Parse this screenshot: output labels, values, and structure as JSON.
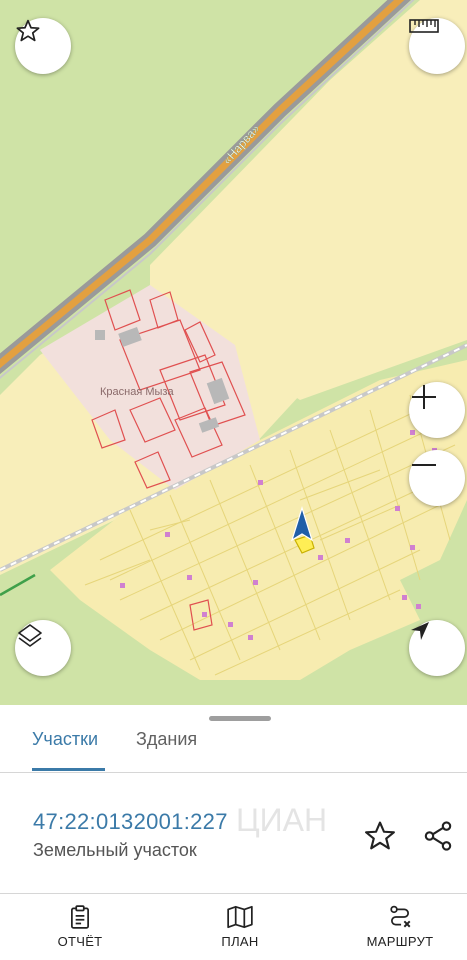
{
  "map": {
    "road_label": "«Нарва»",
    "village_label": "Красная Мыза",
    "controls": {
      "favorite": "star-icon",
      "ruler": "ruler-icon",
      "zoom_in": "plus-icon",
      "zoom_out": "minus-icon",
      "layers": "layers-icon",
      "locate": "navigation-arrow-icon"
    }
  },
  "tabs": {
    "plots": "Участки",
    "buildings": "Здания",
    "active": "plots"
  },
  "parcel": {
    "cadastral_number": "47:22:0132001:227",
    "type": "Земельный участок"
  },
  "watermark": "ЦИАН",
  "bottom_nav": {
    "report": "ОТЧЁТ",
    "plan": "ПЛАН",
    "route": "МАРШРУТ"
  },
  "colors": {
    "accent": "#3b7aa8",
    "map_forest": "#cfe3a6",
    "map_field": "#f8eeba",
    "road_orange": "#e3a040",
    "parcel_border": "#e0cf6a",
    "building_border": "#e05050"
  }
}
